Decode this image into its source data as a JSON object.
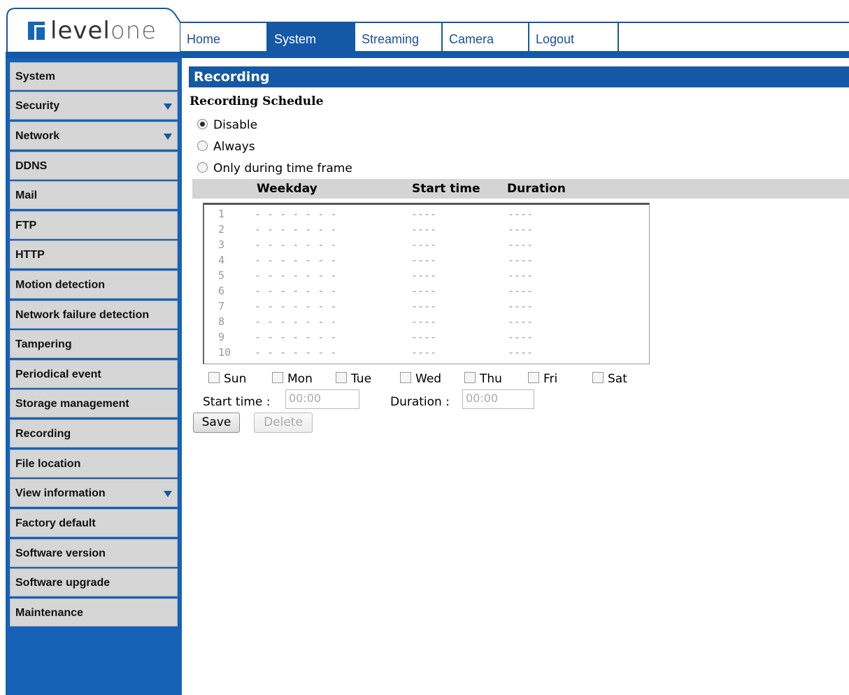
{
  "brand": {
    "logo_text_a": "level",
    "logo_text_b": "one"
  },
  "colors": {
    "accent": "#1558a6",
    "sidebar_bg": "#1662b7",
    "sidebar_item": "#d6d6d6",
    "header_bar": "#d4d4d4"
  },
  "topnav": {
    "tabs": [
      {
        "label": "Home",
        "active": false
      },
      {
        "label": "System",
        "active": true
      },
      {
        "label": "Streaming",
        "active": false
      },
      {
        "label": "Camera",
        "active": false
      },
      {
        "label": "Logout",
        "active": false
      }
    ]
  },
  "sidebar": {
    "items": [
      {
        "label": "System",
        "has_submenu": false
      },
      {
        "label": "Security",
        "has_submenu": true
      },
      {
        "label": "Network",
        "has_submenu": true
      },
      {
        "label": "DDNS",
        "has_submenu": false
      },
      {
        "label": "Mail",
        "has_submenu": false
      },
      {
        "label": "FTP",
        "has_submenu": false
      },
      {
        "label": "HTTP",
        "has_submenu": false
      },
      {
        "label": "Motion detection",
        "has_submenu": false
      },
      {
        "label": "Network failure detection",
        "has_submenu": false
      },
      {
        "label": "Tampering",
        "has_submenu": false
      },
      {
        "label": "Periodical event",
        "has_submenu": false
      },
      {
        "label": "Storage management",
        "has_submenu": false
      },
      {
        "label": "Recording",
        "has_submenu": false
      },
      {
        "label": "File location",
        "has_submenu": false
      },
      {
        "label": "View information",
        "has_submenu": true
      },
      {
        "label": "Factory default",
        "has_submenu": false
      },
      {
        "label": "Software version",
        "has_submenu": false
      },
      {
        "label": "Software upgrade",
        "has_submenu": false
      },
      {
        "label": "Maintenance",
        "has_submenu": false
      }
    ]
  },
  "main": {
    "page_title": "Recording",
    "section_title": "Recording Schedule",
    "radios": [
      {
        "label": "Disable",
        "checked": true
      },
      {
        "label": "Always",
        "checked": false
      },
      {
        "label": "Only during time frame",
        "checked": false
      }
    ],
    "table_headers": {
      "weekday": "Weekday",
      "start_time": "Start time",
      "duration": "Duration"
    },
    "schedule_rows": [
      {
        "num": "1",
        "weekday": "- - - - - - -",
        "start": "----",
        "duration": "----"
      },
      {
        "num": "2",
        "weekday": "- - - - - - -",
        "start": "----",
        "duration": "----"
      },
      {
        "num": "3",
        "weekday": "- - - - - - -",
        "start": "----",
        "duration": "----"
      },
      {
        "num": "4",
        "weekday": "- - - - - - -",
        "start": "----",
        "duration": "----"
      },
      {
        "num": "5",
        "weekday": "- - - - - - -",
        "start": "----",
        "duration": "----"
      },
      {
        "num": "6",
        "weekday": "- - - - - - -",
        "start": "----",
        "duration": "----"
      },
      {
        "num": "7",
        "weekday": "- - - - - - -",
        "start": "----",
        "duration": "----"
      },
      {
        "num": "8",
        "weekday": "- - - - - - -",
        "start": "----",
        "duration": "----"
      },
      {
        "num": "9",
        "weekday": "- - - - - - -",
        "start": "----",
        "duration": "----"
      },
      {
        "num": "10",
        "weekday": "- - - - - - -",
        "start": "----",
        "duration": "----"
      }
    ],
    "days": [
      "Sun",
      "Mon",
      "Tue",
      "Wed",
      "Thu",
      "Fri",
      "Sat"
    ],
    "start_time_label": "Start time :",
    "start_time_value": "00:00",
    "duration_label": "Duration :",
    "duration_value": "00:00",
    "save_label": "Save",
    "delete_label": "Delete"
  }
}
